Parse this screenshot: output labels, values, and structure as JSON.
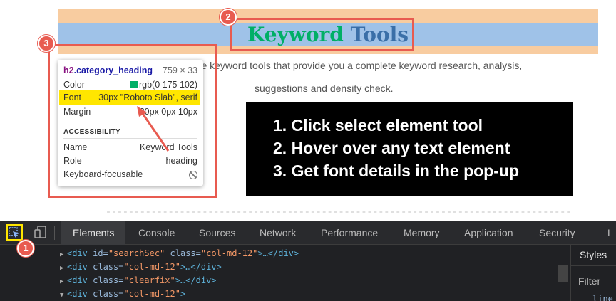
{
  "page": {
    "heading_word1": "Keyword",
    "heading_word2": "Tools",
    "subtext_line1": "ree keyword tools that provide you a complete keyword research, analysis,",
    "subtext_line2": "suggestions and density check."
  },
  "tooltip": {
    "selector_tag": "h2",
    "selector_class": ".category_heading",
    "size": "759 × 33",
    "rows": [
      {
        "label": "Color",
        "value": "rgb(0 175 102)"
      },
      {
        "label": "Font",
        "value": "30px \"Roboto Slab\", serif"
      },
      {
        "label": "Margin",
        "value": "20px 0px 10px"
      }
    ],
    "accessibility_title": "ACCESSIBILITY",
    "a11y_rows": [
      {
        "label": "Name",
        "value": "Keyword Tools"
      },
      {
        "label": "Role",
        "value": "heading"
      },
      {
        "label": "Keyboard-focusable",
        "icon": "not-allowed-icon"
      }
    ],
    "swatch_color": "#00af66"
  },
  "instructions": [
    "1. Click select element tool",
    "2. Hover over any text element",
    "3. Get font details in the pop-up"
  ],
  "badges": [
    "1",
    "2",
    "3"
  ],
  "devtools": {
    "tabs": [
      "Elements",
      "Console",
      "Sources",
      "Network",
      "Performance",
      "Memory",
      "Application",
      "Security",
      "L"
    ],
    "active_tab": "Elements",
    "code_lines": [
      {
        "parts": [
          "<div ",
          "id=",
          "\"searchSec\"",
          " class=",
          "\"col-md-12\"",
          ">…</div>"
        ]
      },
      {
        "parts": [
          "<div ",
          "class=",
          "\"col-md-12\"",
          ">…</div>"
        ]
      },
      {
        "parts": [
          "<div ",
          "class=",
          "\"clearfix\"",
          ">…</div>"
        ]
      },
      {
        "parts": [
          "<div ",
          "class=",
          "\"col-md-12\"",
          ">"
        ]
      }
    ],
    "side_tab": "Styles",
    "filter_placeholder": "Filter",
    "side_fragment": "line"
  },
  "colors": {
    "annotation_red": "#e85b50",
    "heading_green": "#00af66",
    "highlight_yellow": "#ffe600"
  }
}
